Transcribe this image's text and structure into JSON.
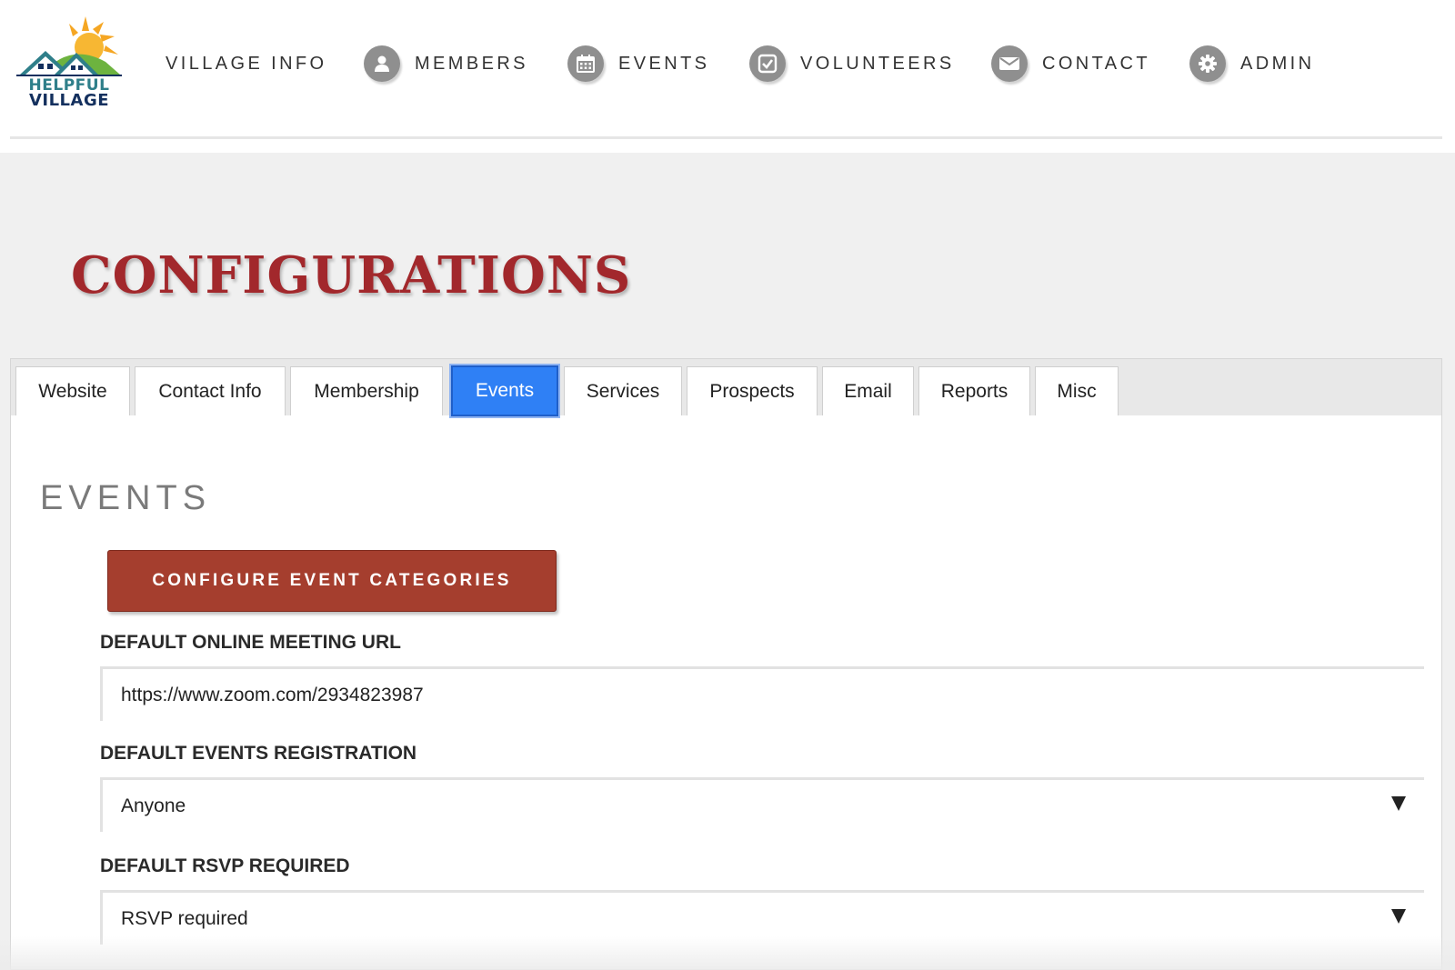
{
  "logo": {
    "line1": "HELPFUL",
    "line2": "VILLAGE",
    "colors": {
      "sun": "#f5a623",
      "roof": "#2f7f8a",
      "hill": "#6db33f",
      "text_dark": "#14305e"
    }
  },
  "nav": {
    "items": [
      {
        "label": "VILLAGE INFO",
        "icon": ""
      },
      {
        "label": "MEMBERS",
        "icon": "person-icon"
      },
      {
        "label": "EVENTS",
        "icon": "calendar-icon"
      },
      {
        "label": "VOLUNTEERS",
        "icon": "checkbox-icon"
      },
      {
        "label": "CONTACT",
        "icon": "envelope-icon"
      },
      {
        "label": "ADMIN",
        "icon": "gear-icon"
      }
    ]
  },
  "page": {
    "title": "CONFIGURATIONS",
    "title_color": "#a2282c"
  },
  "tabs": {
    "items": [
      "Website",
      "Contact Info",
      "Membership",
      "Events",
      "Services",
      "Prospects",
      "Email",
      "Reports",
      "Misc"
    ],
    "active": "Events",
    "active_color": "#2f80f5"
  },
  "events": {
    "section_title": "EVENTS",
    "configure_button": "CONFIGURE EVENT CATEGORIES",
    "button_color": "#a53e2e",
    "meeting_url_label": "DEFAULT ONLINE MEETING URL",
    "meeting_url_value": "https://www.zoom.com/2934823987",
    "registration_label": "DEFAULT EVENTS REGISTRATION",
    "registration_value": "Anyone",
    "rsvp_label": "DEFAULT RSVP REQUIRED",
    "rsvp_value": "RSVP required"
  }
}
